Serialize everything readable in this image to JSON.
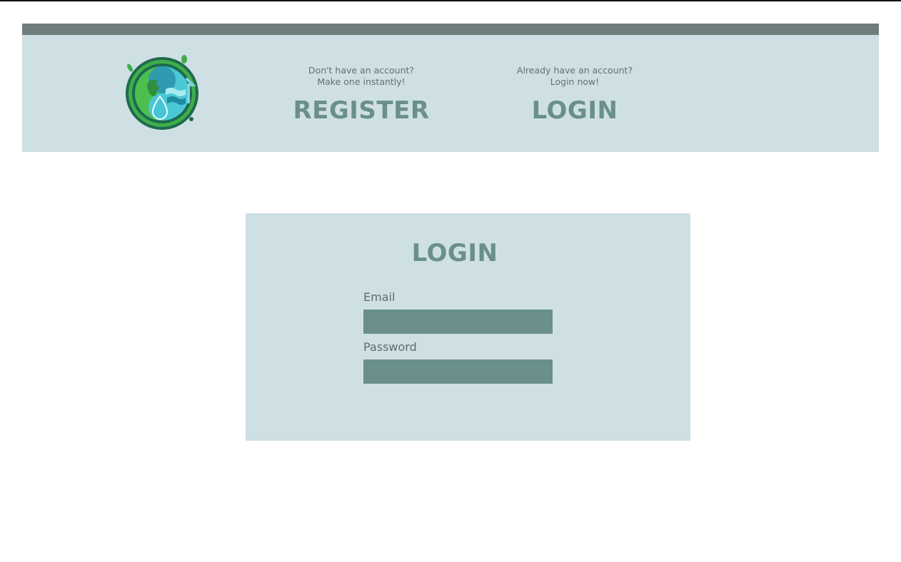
{
  "header": {
    "register": {
      "hint": "Don't have an account?\nMake one instantly!",
      "link_label": "REGISTER"
    },
    "login": {
      "hint": "Already have an account?\nLogin now!",
      "link_label": "LOGIN"
    },
    "logo_icon": "earth-water-drop-recycle-logo"
  },
  "login_form": {
    "title": "LOGIN",
    "email": {
      "label": "Email",
      "value": "",
      "placeholder": ""
    },
    "password": {
      "label": "Password",
      "value": "",
      "placeholder": ""
    }
  },
  "colors": {
    "header_bar": "#6e7d7b",
    "panel_background": "#cfe0e5",
    "accent": "#6a8f8c",
    "text_muted": "#607170"
  }
}
